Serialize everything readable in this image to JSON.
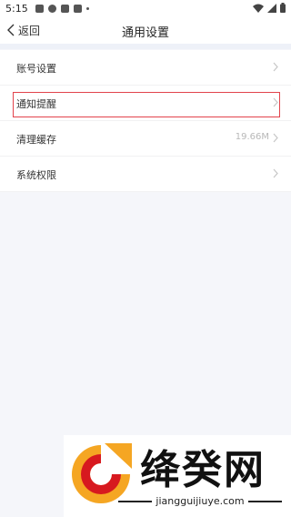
{
  "status_bar": {
    "time": "5:15"
  },
  "nav": {
    "back_label": "返回",
    "title": "通用设置"
  },
  "menu": {
    "items": [
      {
        "label": "账号设置",
        "value": ""
      },
      {
        "label": "通知提醒",
        "value": ""
      },
      {
        "label": "清理缓存",
        "value": "19.66M"
      },
      {
        "label": "系统权限",
        "value": ""
      }
    ]
  },
  "watermark": {
    "name": "绛癸网",
    "url": "jiangguijiuye.com"
  },
  "colors": {
    "highlight": "#e2434b",
    "background": "#f5f6fa",
    "logo_orange": "#f5a623",
    "logo_red": "#d7191f"
  }
}
